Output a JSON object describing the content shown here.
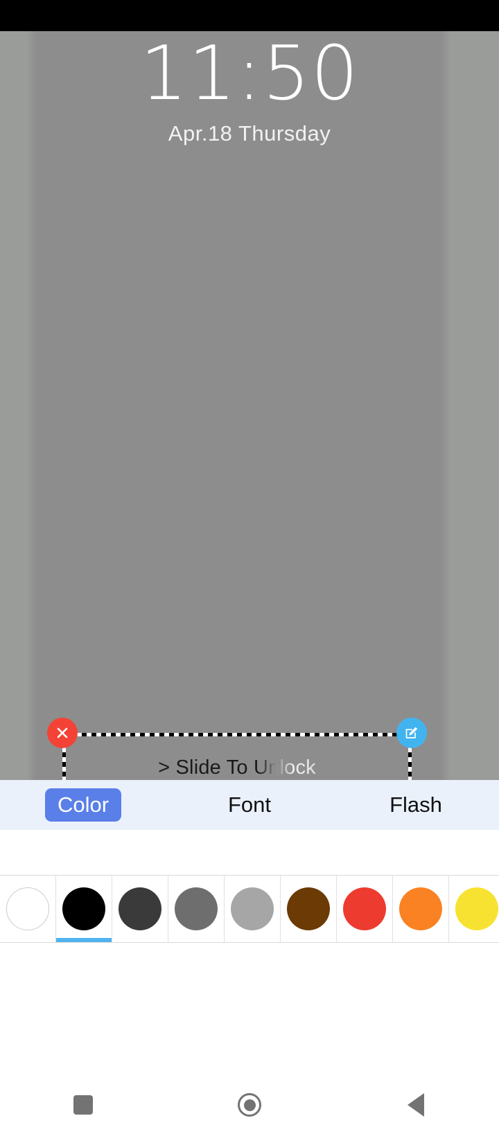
{
  "status_bar": {
    "background": "#000000"
  },
  "lockscreen": {
    "clock": {
      "time": "11:50",
      "date": "Apr.18  Thursday"
    },
    "widget": {
      "text": "> Slide To Unlock",
      "close_icon": "close-x-icon",
      "edit_icon": "edit-pencil-icon",
      "close_color": "#f44336",
      "edit_color": "#41b4f0"
    },
    "wallpaper_color": "#8d8d8d"
  },
  "tabs": {
    "active_index": 0,
    "active_color": "#5a7fe8",
    "background": "#eaf1fb",
    "items": [
      {
        "label": "Color"
      },
      {
        "label": "Font"
      },
      {
        "label": "Flash"
      }
    ]
  },
  "color_picker": {
    "selected_index": 1,
    "selection_indicator_color": "#4fb3f0",
    "swatches": [
      {
        "name": "white",
        "hex": "#ffffff",
        "outlined": true
      },
      {
        "name": "black",
        "hex": "#000000",
        "outlined": false
      },
      {
        "name": "dark-gray",
        "hex": "#3a3a3a",
        "outlined": false
      },
      {
        "name": "gray",
        "hex": "#6e6e6e",
        "outlined": false
      },
      {
        "name": "light-gray",
        "hex": "#a6a6a6",
        "outlined": false
      },
      {
        "name": "brown",
        "hex": "#6b3a05",
        "outlined": false
      },
      {
        "name": "red",
        "hex": "#ed3b2f",
        "outlined": false
      },
      {
        "name": "orange",
        "hex": "#fa8223",
        "outlined": false
      },
      {
        "name": "yellow",
        "hex": "#f7e231",
        "outlined": false
      }
    ]
  },
  "navigation_bar": {
    "icon_color": "#737373",
    "buttons": [
      {
        "name": "recents-button",
        "icon": "square-icon"
      },
      {
        "name": "home-button",
        "icon": "circle-icon"
      },
      {
        "name": "back-button",
        "icon": "triangle-left-icon"
      }
    ]
  }
}
